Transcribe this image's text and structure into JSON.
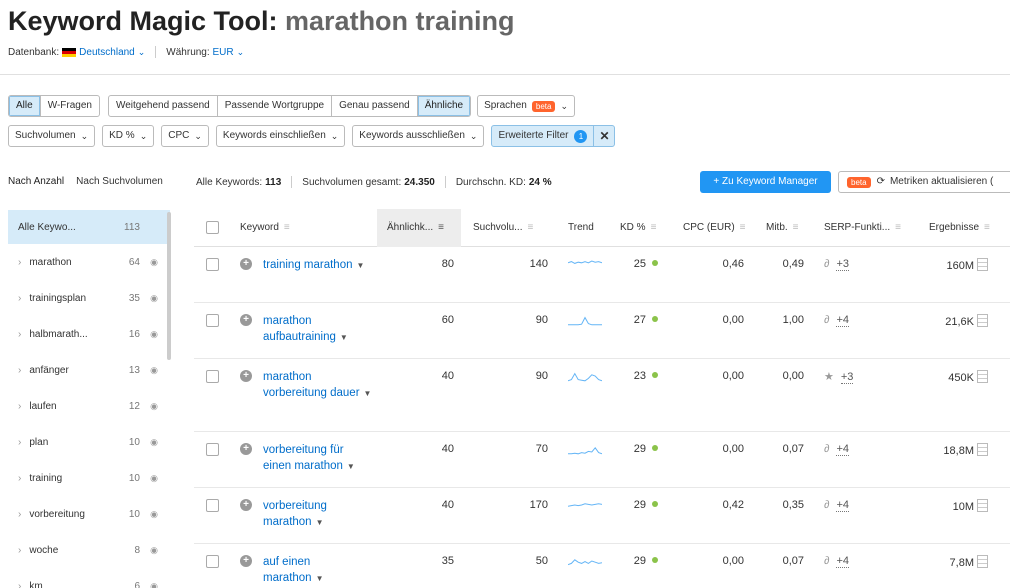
{
  "header": {
    "title_prefix": "Keyword Magic Tool:",
    "title_query": "marathon training",
    "db_label": "Datenbank:",
    "db_value": "Deutschland",
    "currency_label": "Währung:",
    "currency_value": "EUR"
  },
  "filters": {
    "match_types": [
      "Alle",
      "W-Fragen"
    ],
    "match_modes": [
      "Weitgehend passend",
      "Passende Wortgruppe",
      "Genau passend",
      "Ähnliche"
    ],
    "languages_label": "Sprachen",
    "beta": "beta",
    "row2": [
      "Suchvolumen",
      "KD %",
      "CPC",
      "Keywords einschließen",
      "Keywords ausschließen"
    ],
    "advanced_label": "Erweiterte Filter",
    "advanced_count": "1",
    "close": "✕"
  },
  "toolbar": {
    "tab_count": "Nach Anzahl",
    "tab_volume": "Nach Suchvolumen",
    "all_keywords_label": "Alle Keywords:",
    "all_keywords_value": "113",
    "total_volume_label": "Suchvolumen gesamt:",
    "total_volume_value": "24.350",
    "avg_kd_label": "Durchschn. KD:",
    "avg_kd_value": "24 %",
    "keyword_manager": "+ Zu Keyword Manager",
    "beta": "beta",
    "update_metrics": "Metriken aktualisieren ("
  },
  "sidebar": {
    "all": {
      "label": "Alle Keywo...",
      "count": "113"
    },
    "groups": [
      {
        "label": "marathon",
        "count": "64"
      },
      {
        "label": "trainingsplan",
        "count": "35"
      },
      {
        "label": "halbmarath...",
        "count": "16"
      },
      {
        "label": "anfänger",
        "count": "13"
      },
      {
        "label": "laufen",
        "count": "12"
      },
      {
        "label": "plan",
        "count": "10"
      },
      {
        "label": "training",
        "count": "10"
      },
      {
        "label": "vorbereitung",
        "count": "10"
      },
      {
        "label": "woche",
        "count": "8"
      },
      {
        "label": "km",
        "count": "6"
      }
    ]
  },
  "table": {
    "headers": {
      "keyword": "Keyword",
      "similarity": "Ähnlichk...",
      "volume": "Suchvolu...",
      "trend": "Trend",
      "kd": "KD %",
      "cpc": "CPC (EUR)",
      "comp": "Mitb.",
      "serp": "SERP-Funkti...",
      "results": "Ergebnisse"
    },
    "rows": [
      {
        "keyword": "training marathon",
        "similarity": "80",
        "volume": "140",
        "kd": "25",
        "cpc": "0,46",
        "comp": "0,49",
        "serp_icon": "link-icon",
        "serp_more": "+3",
        "results": "160M",
        "trend": [
          0.6,
          0.7,
          0.55,
          0.65,
          0.6,
          0.7,
          0.6,
          0.75,
          0.65,
          0.7,
          0.6
        ]
      },
      {
        "keyword": "marathon aufbautraining",
        "similarity": "60",
        "volume": "90",
        "kd": "27",
        "cpc": "0,00",
        "comp": "1,00",
        "serp_icon": "link-icon",
        "serp_more": "+4",
        "results": "21,6K",
        "trend": [
          0.1,
          0.1,
          0.1,
          0.1,
          0.15,
          0.7,
          0.2,
          0.1,
          0.1,
          0.1,
          0.1
        ]
      },
      {
        "keyword": "marathon vorbereitung dauer",
        "similarity": "40",
        "volume": "90",
        "kd": "23",
        "cpc": "0,00",
        "comp": "0,00",
        "serp_icon": "star-icon",
        "serp_more": "+3",
        "results": "450K",
        "trend": [
          0.1,
          0.2,
          0.7,
          0.2,
          0.15,
          0.1,
          0.3,
          0.6,
          0.5,
          0.2,
          0.1
        ]
      },
      {
        "keyword": "vorbereitung für einen marathon",
        "similarity": "40",
        "volume": "70",
        "kd": "29",
        "cpc": "0,00",
        "comp": "0,07",
        "serp_icon": "link-icon",
        "serp_more": "+4",
        "results": "18,8M",
        "trend": [
          0.1,
          0.1,
          0.15,
          0.1,
          0.2,
          0.15,
          0.3,
          0.25,
          0.6,
          0.2,
          0.1
        ]
      },
      {
        "keyword": "vorbereitung marathon",
        "similarity": "40",
        "volume": "170",
        "kd": "29",
        "cpc": "0,42",
        "comp": "0,35",
        "serp_icon": "link-icon",
        "serp_more": "+4",
        "results": "10M",
        "trend": [
          0.4,
          0.45,
          0.5,
          0.45,
          0.5,
          0.6,
          0.55,
          0.5,
          0.55,
          0.6,
          0.55
        ]
      },
      {
        "keyword": "auf einen marathon",
        "similarity": "35",
        "volume": "50",
        "kd": "29",
        "cpc": "0,00",
        "comp": "0,07",
        "serp_icon": "link-icon",
        "serp_more": "+4",
        "results": "7,8M",
        "trend": [
          0.2,
          0.3,
          0.6,
          0.4,
          0.3,
          0.45,
          0.3,
          0.5,
          0.4,
          0.3,
          0.35
        ]
      }
    ]
  },
  "colors": {
    "accent": "#2196f3",
    "link": "#006dca",
    "kd_dot": "#8bc34a",
    "beta": "#ff642d"
  }
}
